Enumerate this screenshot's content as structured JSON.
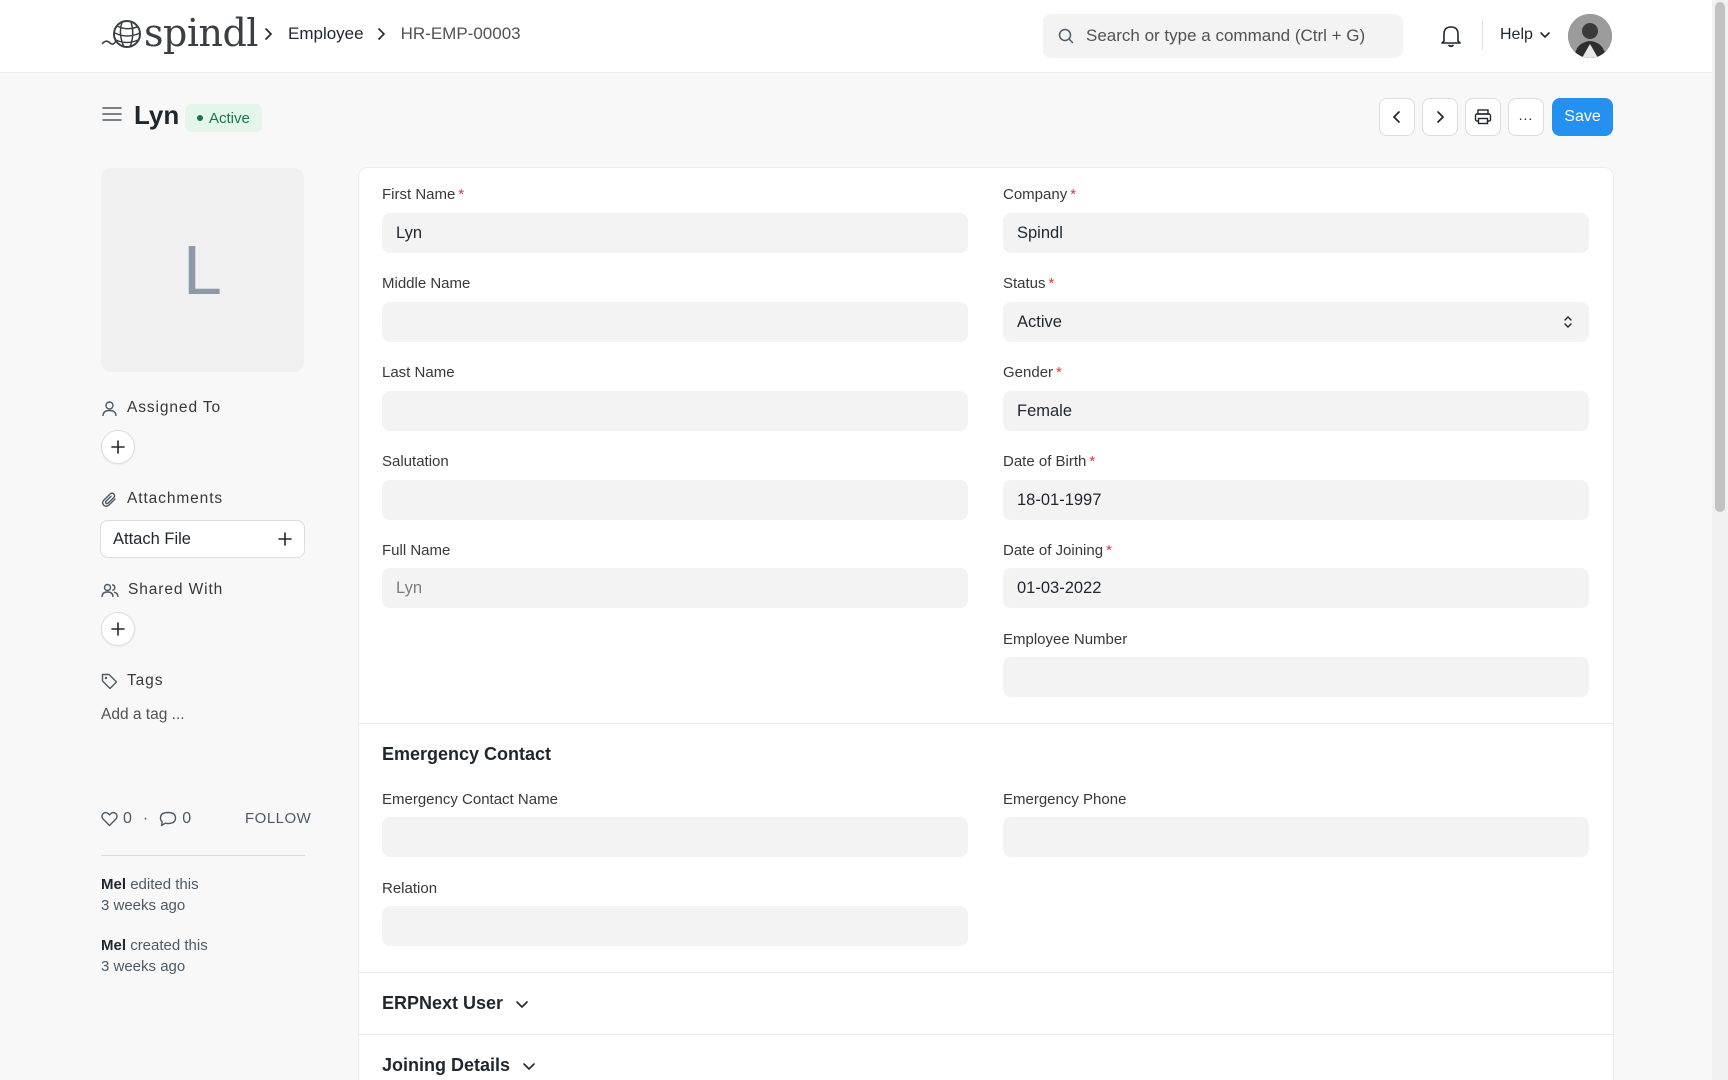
{
  "navbar": {
    "logo_text": "spindl",
    "breadcrumbs": [
      "Employee",
      "HR-EMP-00003"
    ],
    "search_placeholder": "Search or type a command (Ctrl + G)",
    "help_label": "Help"
  },
  "page": {
    "title": "Lyn",
    "status": "Active",
    "save_label": "Save",
    "more_label": "..."
  },
  "sidebar": {
    "avatar_initial": "L",
    "assigned_to_label": "Assigned To",
    "attachments_label": "Attachments",
    "attach_file_label": "Attach File",
    "shared_with_label": "Shared With",
    "tags_label": "Tags",
    "add_tag_label": "Add a tag ...",
    "likes_count": "0",
    "stats_separator": "·",
    "comments_count": "0",
    "follow_label": "FOLLOW",
    "activity": [
      {
        "user": "Mel",
        "action": "edited this",
        "time": "3 weeks ago"
      },
      {
        "user": "Mel",
        "action": "created this",
        "time": "3 weeks ago"
      }
    ]
  },
  "form": {
    "left_fields": [
      {
        "label": "First Name",
        "required": "*",
        "value": "Lyn"
      },
      {
        "label": "Middle Name",
        "value": ""
      },
      {
        "label": "Last Name",
        "value": ""
      },
      {
        "label": "Salutation",
        "value": ""
      },
      {
        "label": "Full Name",
        "value": "Lyn"
      }
    ],
    "right_fields": [
      {
        "label": "Company",
        "required": "*",
        "value": "Spindl"
      },
      {
        "label": "Status",
        "required": "*",
        "value": "Active"
      },
      {
        "label": "Gender",
        "required": "*",
        "value": "Female"
      },
      {
        "label": "Date of Birth",
        "required": "*",
        "value": "18-01-1997"
      },
      {
        "label": "Date of Joining",
        "required": "*",
        "value": "01-03-2022"
      },
      {
        "label": "Employee Number",
        "value": ""
      }
    ],
    "emergency_section": {
      "title": "Emergency Contact",
      "contact_name_label": "Emergency Contact Name",
      "contact_name_value": "",
      "phone_label": "Emergency Phone",
      "phone_value": "",
      "relation_label": "Relation",
      "relation_value": ""
    },
    "collapsed_sections": [
      "ERPNext User",
      "Joining Details"
    ]
  },
  "colors": {
    "primary": "#2490ef",
    "status_bg": "#e4f5e9",
    "status_text": "#16794c",
    "required": "#e03636"
  }
}
